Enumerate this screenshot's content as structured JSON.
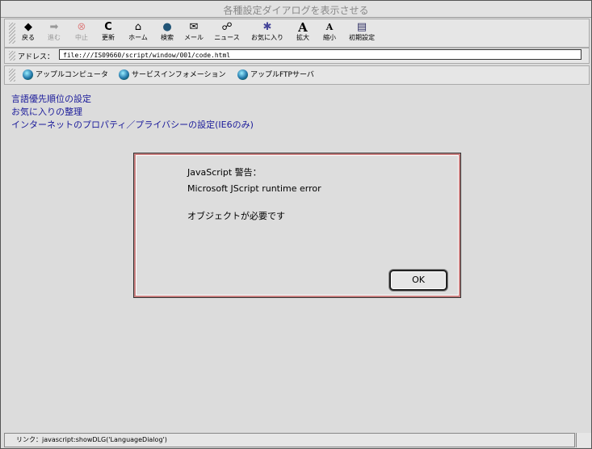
{
  "window": {
    "title": "各種設定ダイアログを表示させる"
  },
  "toolbar": {
    "buttons": [
      {
        "icon": "back-icon",
        "glyph": "◆",
        "label": "戻る",
        "enabled": true
      },
      {
        "icon": "forward-icon",
        "glyph": "➡",
        "label": "進む",
        "enabled": false
      },
      {
        "icon": "stop-icon",
        "glyph": "⊗",
        "label": "中止",
        "enabled": false
      },
      {
        "icon": "refresh-icon",
        "glyph": "C",
        "label": "更新",
        "enabled": true
      },
      {
        "icon": "home-icon",
        "glyph": "⌂",
        "label": "ホーム",
        "enabled": true
      },
      {
        "icon": "search-icon",
        "glyph": "●",
        "label": "検索",
        "enabled": true
      },
      {
        "icon": "mail-icon",
        "glyph": "✉",
        "label": "メール",
        "enabled": true
      },
      {
        "icon": "news-icon",
        "glyph": "☍",
        "label": "ニュース",
        "enabled": true
      },
      {
        "icon": "favorites-icon",
        "glyph": "✱",
        "label": "お気に入り",
        "enabled": true
      },
      {
        "icon": "text-larger-icon",
        "glyph": "A",
        "label": "拡大",
        "enabled": true
      },
      {
        "icon": "text-smaller-icon",
        "glyph": "A",
        "label": "縮小",
        "enabled": true
      },
      {
        "icon": "preferences-icon",
        "glyph": "▤",
        "label": "初期設定",
        "enabled": true
      }
    ]
  },
  "address": {
    "label": "アドレス：",
    "value": "file:///IS09660/script/window/001/code.html"
  },
  "favorites": [
    {
      "label": "アップルコンピュータ"
    },
    {
      "label": "サービスインフォメーション"
    },
    {
      "label": "アップルFTPサーバ"
    }
  ],
  "content": {
    "links": [
      "言語優先順位の設定",
      "お気に入りの整理",
      "インターネットのプロパティ／プライバシーの設定(IE6のみ)"
    ]
  },
  "dialog": {
    "heading": "JavaScript 警告：",
    "error": "Microsoft JScript runtime error",
    "message": "オブジェクトが必要です",
    "ok_label": "OK"
  },
  "status": {
    "text": "リンク：javascript:showDLG('LanguageDialog')"
  }
}
